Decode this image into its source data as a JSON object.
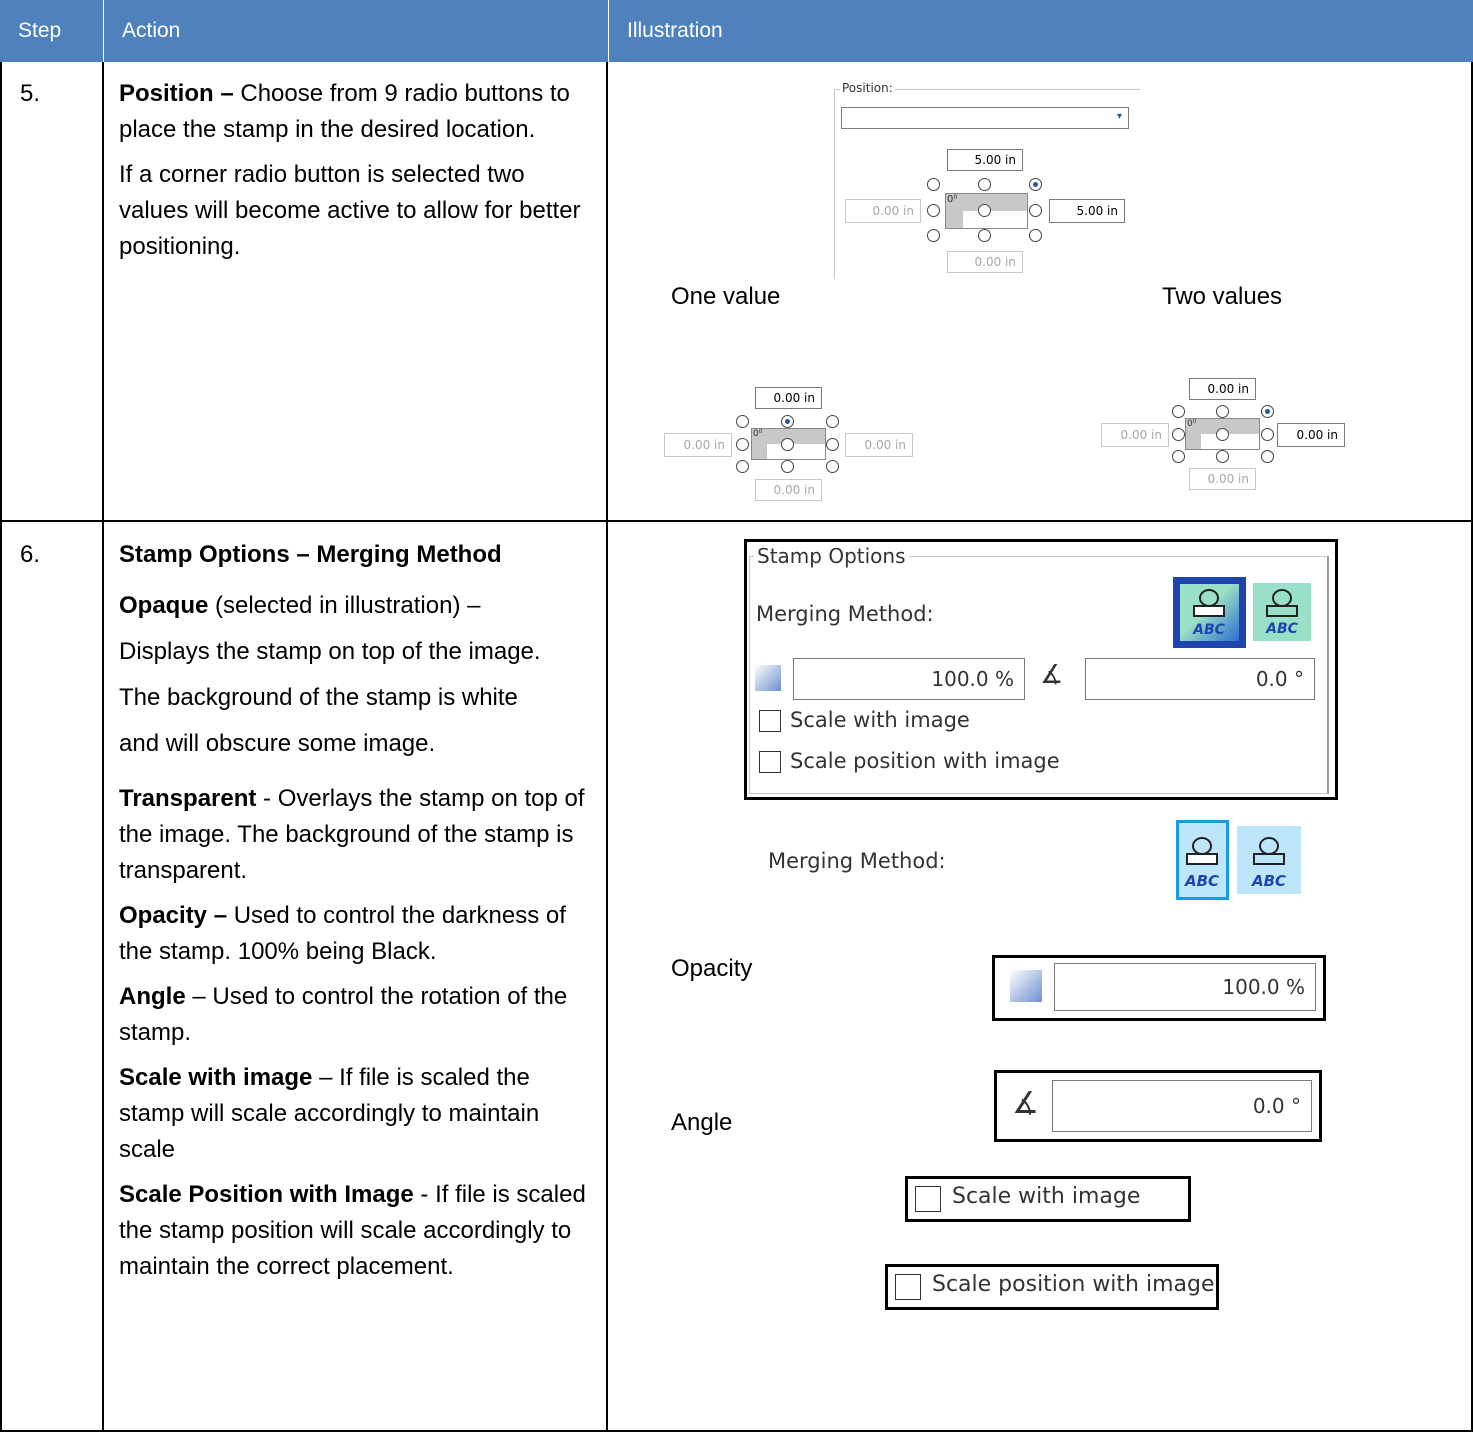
{
  "header": {
    "step": "Step",
    "action": "Action",
    "illustration": "Illustration"
  },
  "row5": {
    "step": "5.",
    "title_bold": "Position –",
    "title_rest": " Choose from 9 radio buttons to place the stamp in the desired location.",
    "para2": "If a corner radio button is selected two values will become active to allow for better positioning.",
    "illustration": {
      "position_label": "Position:",
      "main_top": "5.00 in",
      "main_left": "0.00 in",
      "main_right": "5.00 in",
      "main_bottom": "0.00 in",
      "angle_glyph": "0⁰",
      "one_value_caption": "One value",
      "two_values_caption": "Two values",
      "one_top": "0.00 in",
      "one_left": "0.00 in",
      "one_right": "0.00 in",
      "one_bottom": "0.00 in",
      "two_top": "0.00 in",
      "two_left": "0.00 in",
      "two_right": "0.00 in",
      "two_bottom": "0.00 in"
    }
  },
  "row6": {
    "step": "6.",
    "title": "Stamp Options – Merging Method",
    "opaque_bold": "Opaque",
    "opaque_rest": " (selected in illustration) –",
    "opaque_line2": "Displays the stamp on top of the image.",
    "opaque_line3": "The background of the stamp is white",
    "opaque_line4": "and will obscure some image.",
    "transparent_bold": "Transparent",
    "transparent_rest": " - Overlays the stamp on top of the image. The background of the stamp is transparent.",
    "opacity_bold": "Opacity –",
    "opacity_rest": " Used to control the darkness of the stamp. 100% being Black.",
    "angle_bold": "Angle",
    "angle_rest": " – Used to control the rotation of the stamp.",
    "scale_bold": "Scale with image",
    "scale_rest": " – If file is scaled the stamp will scale accordingly to maintain scale",
    "scalepos_bold": "Scale Position with Image",
    "scalepos_rest": " - If file is scaled the stamp position will scale accordingly to maintain the correct placement.",
    "illustration": {
      "stamp_options_legend": "Stamp Options",
      "merging_method_label": "Merging Method:",
      "opacity_value": "100.0 %",
      "angle_value": "0.0 °",
      "scale_with_image": "Scale with image",
      "scale_position_with_image": "Scale position with image",
      "merging_method_label_2": "Merging Method:",
      "opacity_caption": "Opacity",
      "opacity_value_2": "100.0 %",
      "angle_caption": "Angle",
      "angle_value_2": "0.0 °",
      "scale_with_image_2": "Scale with image",
      "scale_position_with_image_2": "Scale position with image",
      "stamp_text": "ABC",
      "angle_symbol": "∡"
    }
  }
}
